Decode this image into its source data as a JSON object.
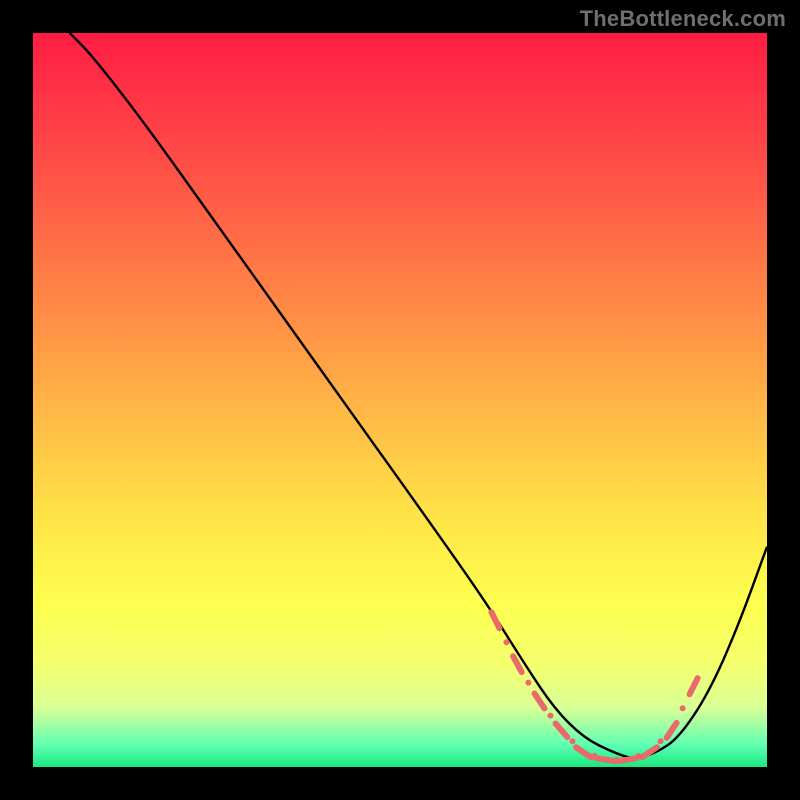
{
  "attribution": "TheBottleneck.com",
  "chart_data": {
    "type": "line",
    "title": "",
    "xlabel": "",
    "ylabel": "",
    "xlim": [
      0,
      100
    ],
    "ylim": [
      0,
      100
    ],
    "grid": false,
    "series": [
      {
        "name": "curve",
        "color": "#000000",
        "x": [
          5,
          8,
          15,
          25,
          35,
          45,
          55,
          62,
          67,
          71,
          75,
          79,
          82,
          85,
          88,
          92,
          96,
          100
        ],
        "y": [
          100,
          97,
          88,
          74,
          60,
          46,
          32,
          22,
          14,
          8,
          4,
          2,
          1,
          2,
          4,
          10,
          19,
          30
        ]
      },
      {
        "name": "dotted-band",
        "color": "#e86a6a",
        "style": "dotted",
        "x": [
          63,
          66,
          69,
          72,
          75,
          78,
          81,
          84,
          87,
          90
        ],
        "y": [
          20,
          14,
          9,
          5,
          2,
          1,
          1,
          2,
          5,
          11
        ]
      }
    ]
  }
}
